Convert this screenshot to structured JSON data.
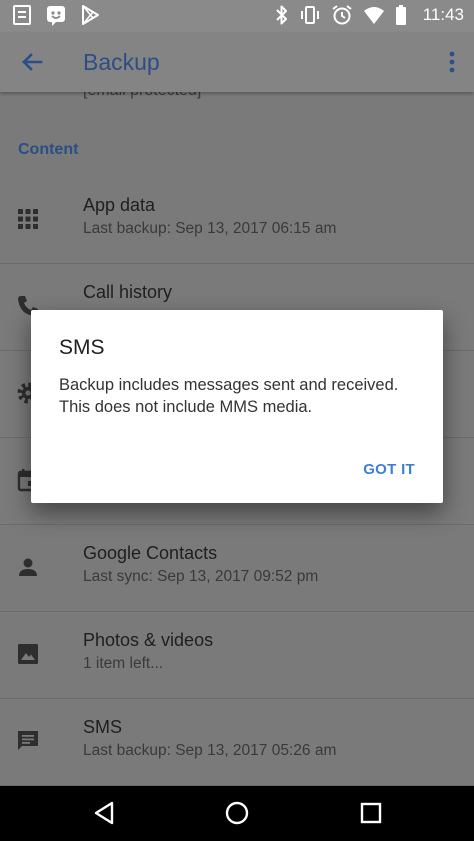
{
  "status_bar": {
    "time": "11:43",
    "left_icons": [
      "notes-icon",
      "messenger-icon",
      "play-store-icon"
    ],
    "right_icons": [
      "bluetooth-icon",
      "vibrate-icon",
      "alarm-icon",
      "wifi-icon",
      "battery-icon"
    ]
  },
  "app_bar": {
    "title": "Backup"
  },
  "content": {
    "account_email": "[email protected]",
    "section_header": "Content",
    "items": [
      {
        "title": "App data",
        "subtitle": "Last backup: Sep 13, 2017 06:15 am",
        "icon": "apps-grid-icon"
      },
      {
        "title": "Call history",
        "subtitle": "",
        "icon": "phone-icon"
      },
      {
        "title": "",
        "subtitle": "",
        "icon": "settings-icon"
      },
      {
        "title": "",
        "subtitle": "",
        "icon": "calendar-icon"
      },
      {
        "title": "Google Contacts",
        "subtitle": "Last sync: Sep 13, 2017 09:52 pm",
        "icon": "person-icon"
      },
      {
        "title": "Photos & videos",
        "subtitle": "1 item left...",
        "icon": "image-icon"
      },
      {
        "title": "SMS",
        "subtitle": "Last backup: Sep 13, 2017 05:26 am",
        "icon": "message-icon"
      }
    ]
  },
  "dialog": {
    "title": "SMS",
    "message": "Backup includes messages sent and received. This does not include MMS media.",
    "action": "GOT IT"
  },
  "colors": {
    "accent": "#3f7fd0",
    "title_blue": "#2c4e86",
    "scrim_gray": "#7a7a7a"
  }
}
